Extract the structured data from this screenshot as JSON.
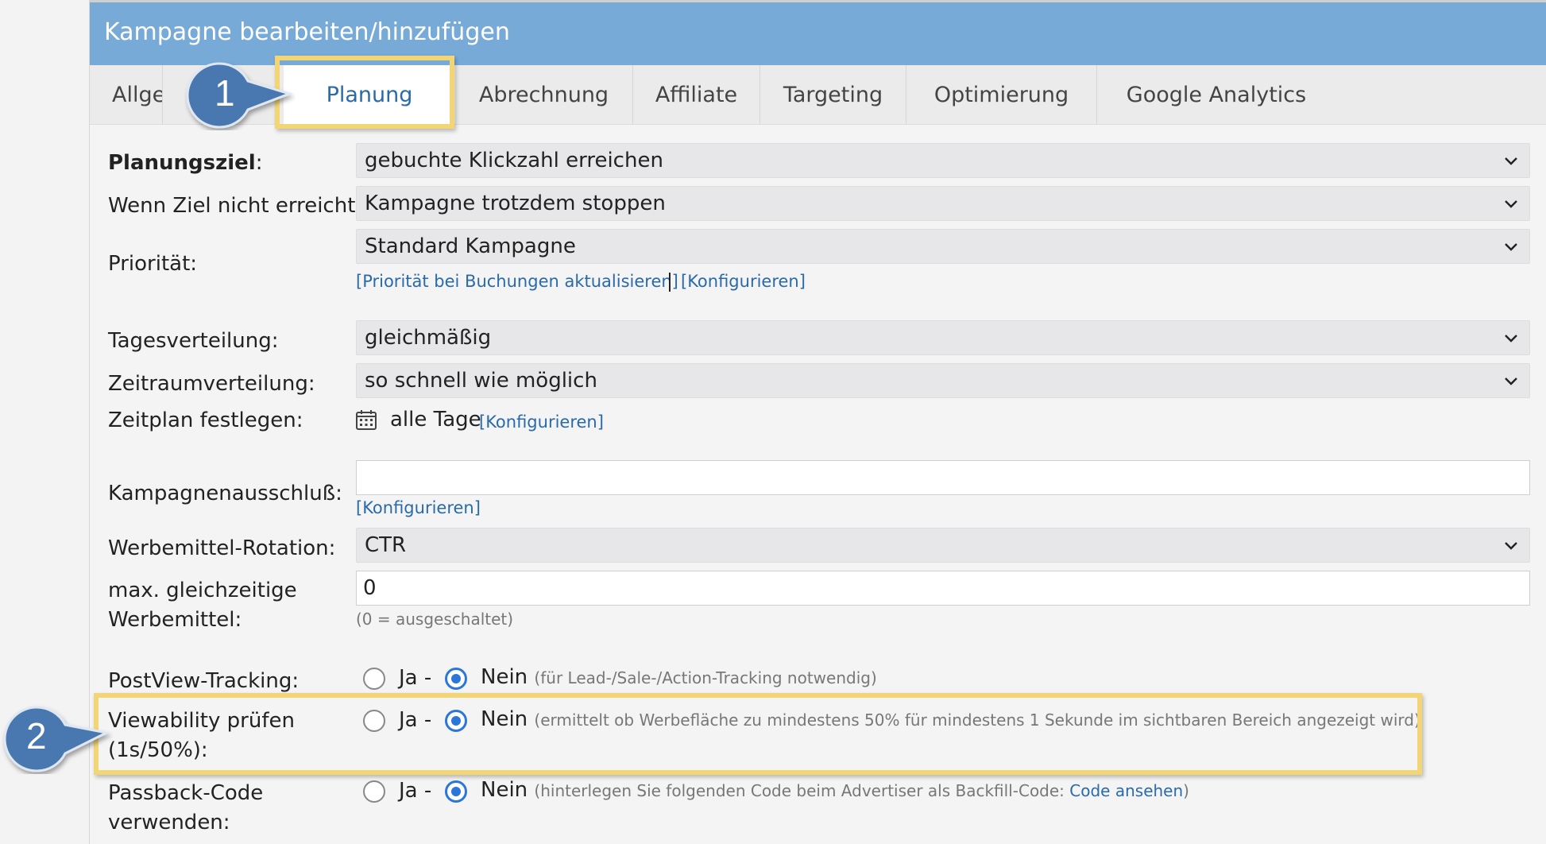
{
  "header": {
    "title": "Kampagne bearbeiten/hinzufügen"
  },
  "tabs": [
    {
      "label": "Allgemein"
    },
    {
      "label": "Planung"
    },
    {
      "label": "Abrechnung"
    },
    {
      "label": "Affiliate"
    },
    {
      "label": "Targeting"
    },
    {
      "label": "Optimierung"
    },
    {
      "label": "Google Analytics"
    }
  ],
  "callouts": {
    "one": "1",
    "two": "2"
  },
  "form": {
    "planungsziel": {
      "label": "Planungsziel",
      "colon": ":",
      "value": "gebuchte Klickzahl erreichen"
    },
    "wenn_ziel": {
      "label": "Wenn Ziel nicht erreicht:",
      "value": "Kampagne trotzdem stoppen"
    },
    "prioritaet": {
      "label": "Priorität:",
      "value": "Standard Kampagne",
      "link_update": "[Priorität bei Buchungen aktualisieren]",
      "link_config": "[Konfigurieren]"
    },
    "tagesverteilung": {
      "label": "Tagesverteilung:",
      "value": "gleichmäßig"
    },
    "zeitraumverteilung": {
      "label": "Zeitraumverteilung:",
      "value": "so schnell wie möglich"
    },
    "zeitplan": {
      "label": "Zeitplan festlegen:",
      "value": "alle Tage",
      "link": "[Konfigurieren]",
      "icon": "calendar-icon"
    },
    "ausschluss": {
      "label": "Kampagnenausschluß:",
      "value": "",
      "link": "[Konfigurieren]"
    },
    "rotation": {
      "label": "Werbemittel-Rotation:",
      "value": "CTR"
    },
    "max_gleichzeitig": {
      "label_line1": "max. gleichzeitige",
      "label_line2": "Werbemittel:",
      "value": "0",
      "hint": "(0 = ausgeschaltet)"
    },
    "postview": {
      "label": "PostView-Tracking:",
      "ja": "Ja -",
      "nein": "Nein",
      "hint": "(für Lead-/Sale-/Action-Tracking notwendig)",
      "selected": "nein"
    },
    "viewability": {
      "label_line1": "Viewability prüfen",
      "label_line2": "(1s/50%):",
      "ja": "Ja -",
      "nein": "Nein",
      "hint": "(ermittelt ob Werbefläche zu mindestens 50% für mindestens 1 Sekunde im sichtbaren Bereich angezeigt wird)",
      "selected": "nein"
    },
    "passback": {
      "label_line1": "Passback-Code",
      "label_line2": "verwenden:",
      "ja": "Ja -",
      "nein": "Nein",
      "hint_prefix": "(hinterlegen Sie folgenden Code beim Advertiser als Backfill-Code: ",
      "hint_link": "Code ansehen",
      "hint_suffix": ")",
      "selected": "nein"
    }
  },
  "colors": {
    "header_bg": "#78aad7",
    "highlight": "#f2d675",
    "callout": "#4a78b0",
    "link": "#2a6aa8",
    "radio": "#2c76d9"
  }
}
